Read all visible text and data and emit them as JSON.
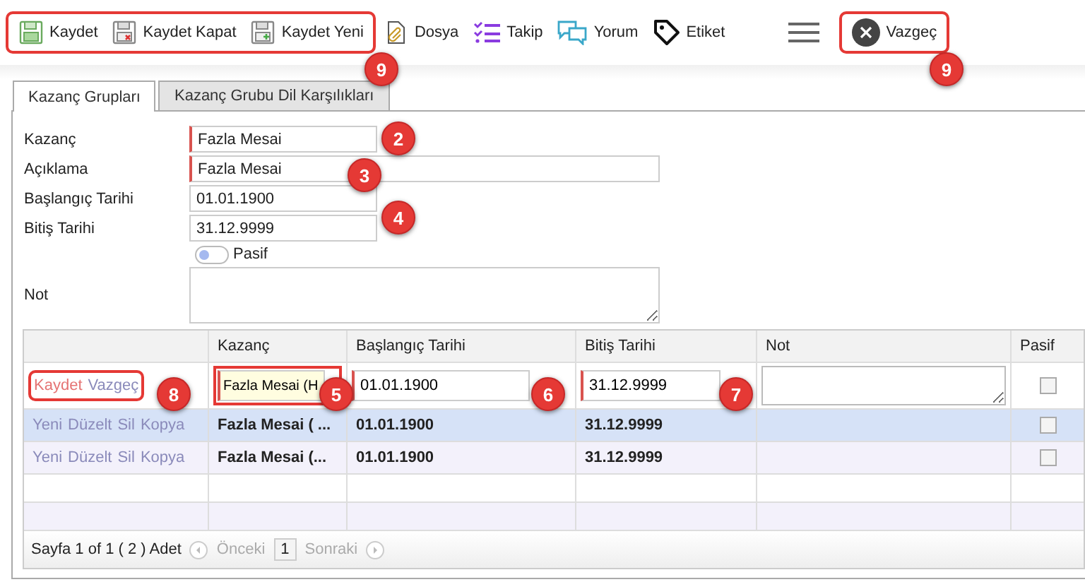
{
  "toolbar": {
    "items": [
      {
        "kind": "save",
        "label": "Kaydet"
      },
      {
        "kind": "save-close",
        "label": "Kaydet Kapat"
      },
      {
        "kind": "save-new",
        "label": "Kaydet Yeni"
      },
      {
        "kind": "file",
        "label": "Dosya"
      },
      {
        "kind": "follow",
        "label": "Takip"
      },
      {
        "kind": "comment",
        "label": "Yorum"
      },
      {
        "kind": "tag",
        "label": "Etiket"
      }
    ],
    "cancel": "Vazgeç"
  },
  "tabs": [
    {
      "label": "Kazanç Grupları",
      "selected": true
    },
    {
      "label": "Kazanç Grubu Dil Karşılıkları",
      "selected": false
    }
  ],
  "form": {
    "fields": [
      {
        "label": "Kazanç",
        "value": "Fazla Mesai",
        "required": true,
        "wide": false
      },
      {
        "label": "Açıklama",
        "value": "Fazla Mesai",
        "required": true,
        "wide": true
      },
      {
        "label": "Başlangıç Tarihi",
        "value": "01.01.1900",
        "required": false,
        "wide": false
      },
      {
        "label": "Bitiş Tarihi",
        "value": "31.12.9999",
        "required": false,
        "wide": false
      }
    ],
    "pasif": {
      "label": "Pasif",
      "on": false
    },
    "note_label": "Not"
  },
  "table": {
    "columns": [
      "",
      "Kazanç",
      "Başlangıç Tarihi",
      "Bitiş Tarihi",
      "Not",
      "Pasif"
    ],
    "edit_row": {
      "save": "Kaydet",
      "cancel": "Vazgeç",
      "kazanc": "Fazla Mesai (H",
      "start": "01.01.1900",
      "end": "31.12.9999",
      "pasif": false
    },
    "rows": [
      {
        "actions": [
          "Yeni",
          "Düzelt",
          "Sil",
          "Kopya"
        ],
        "kazanc": "Fazla Mesai ( ...",
        "start": "01.01.1900",
        "end": "31.12.9999",
        "pasif": false,
        "selected": true
      },
      {
        "actions": [
          "Yeni",
          "Düzelt",
          "Sil",
          "Kopya"
        ],
        "kazanc": "Fazla Mesai (...",
        "start": "01.01.1900",
        "end": "31.12.9999",
        "pasif": false,
        "selected": false
      }
    ],
    "pager": {
      "info": "Sayfa 1 of 1 ( 2 ) Adet",
      "prev": "Önceki",
      "page": "1",
      "next": "Sonraki"
    }
  },
  "annotations": [
    "9",
    "9",
    "2",
    "3",
    "4",
    "8",
    "5",
    "6",
    "7"
  ]
}
